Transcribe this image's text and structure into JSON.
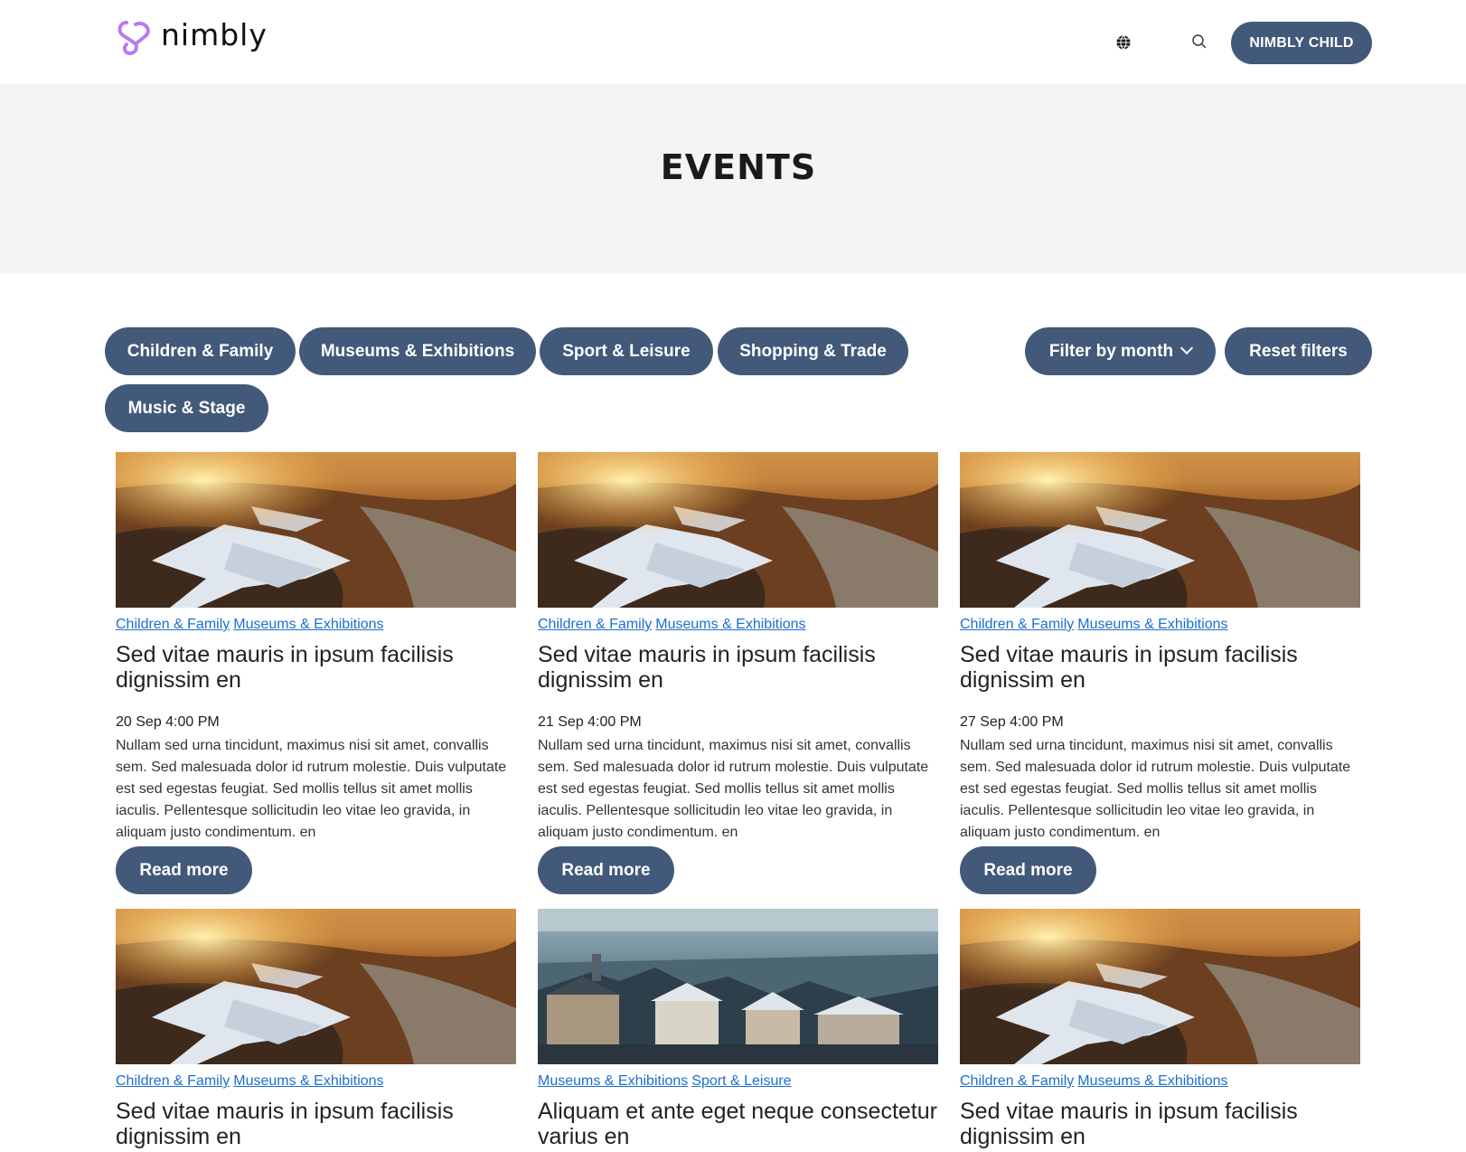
{
  "header": {
    "logo_text": "nimbly",
    "cta_label": "NIMBLY CHILD"
  },
  "hero": {
    "title": "EVENTS"
  },
  "filters": {
    "categories": [
      "Children & Family",
      "Museums & Exhibitions",
      "Sport & Leisure",
      "Shopping & Trade",
      "Music & Stage"
    ],
    "month_label": "Filter by month",
    "reset_label": "Reset filters"
  },
  "events": [
    {
      "image": "landscape-snow",
      "categories": [
        "Children & Family",
        "Museums & Exhibitions"
      ],
      "title": "Sed vitae mauris in ipsum facilisis dignissim en",
      "date": "20 Sep 4:00 PM",
      "description": "Nullam sed urna tincidunt, maximus nisi sit amet, convallis sem. Sed malesuada dolor id rutrum molestie. Duis vulputate est sed egestas feugiat. Sed mollis tellus sit amet mollis iaculis. Pellentesque sollicitudin leo vitae leo gravida, in aliquam justo condimentum. en",
      "read_more": "Read more"
    },
    {
      "image": "landscape-snow",
      "categories": [
        "Children & Family",
        "Museums & Exhibitions"
      ],
      "title": "Sed vitae mauris in ipsum facilisis dignissim en",
      "date": "21 Sep 4:00 PM",
      "description": "Nullam sed urna tincidunt, maximus nisi sit amet, convallis sem. Sed malesuada dolor id rutrum molestie. Duis vulputate est sed egestas feugiat. Sed mollis tellus sit amet mollis iaculis. Pellentesque sollicitudin leo vitae leo gravida, in aliquam justo condimentum. en",
      "read_more": "Read more"
    },
    {
      "image": "landscape-snow",
      "categories": [
        "Children & Family",
        "Museums & Exhibitions"
      ],
      "title": "Sed vitae mauris in ipsum facilisis dignissim en",
      "date": "27 Sep 4:00 PM",
      "description": "Nullam sed urna tincidunt, maximus nisi sit amet, convallis sem. Sed malesuada dolor id rutrum molestie. Duis vulputate est sed egestas feugiat. Sed mollis tellus sit amet mollis iaculis. Pellentesque sollicitudin leo vitae leo gravida, in aliquam justo condimentum. en",
      "read_more": "Read more"
    },
    {
      "image": "landscape-snow",
      "categories": [
        "Children & Family",
        "Museums & Exhibitions"
      ],
      "title": "Sed vitae mauris in ipsum facilisis dignissim en"
    },
    {
      "image": "city-rooftops",
      "categories": [
        "Museums & Exhibitions",
        "Sport & Leisure"
      ],
      "title": "Aliquam et ante eget neque consectetur varius en"
    },
    {
      "image": "landscape-snow",
      "categories": [
        "Children & Family",
        "Museums & Exhibitions"
      ],
      "title": "Sed vitae mauris in ipsum facilisis dignissim en"
    }
  ],
  "colors": {
    "primary": "#43597a",
    "link": "#1b6fd0",
    "hero_bg": "#f4f4f5",
    "logo_accent": "#b57cf0"
  }
}
